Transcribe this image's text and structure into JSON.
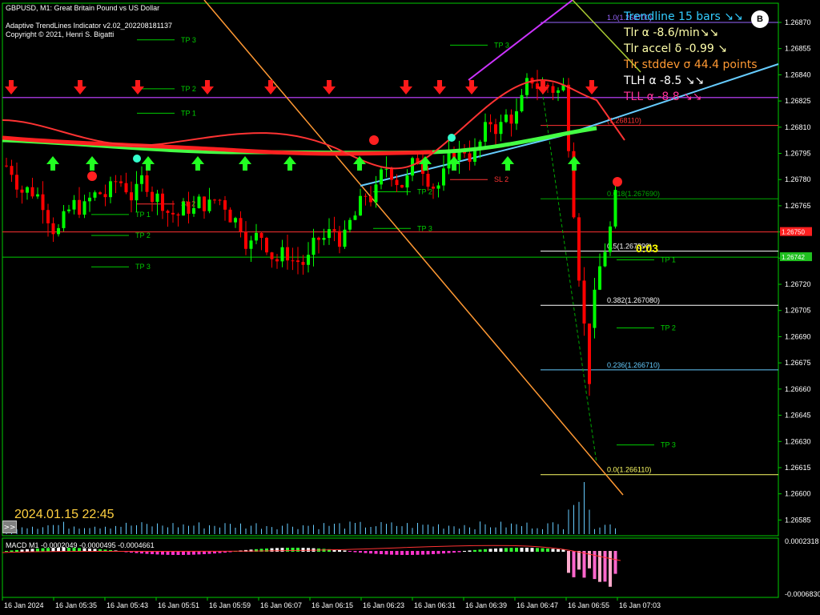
{
  "header": {
    "symbol_line": "GBPUSD, M1:  Great Britain Pound vs US Dollar",
    "indicator_line": "Adaptive TrendLines Indicator v2.02_202208181137",
    "copyright_line": "Copyright © 2021, Henri S. Bigatti"
  },
  "overlay": [
    {
      "text": "Trendline 15 bars ↘↘",
      "color": "#33ccff"
    },
    {
      "text": "Tlr α -8.6/min↘↘",
      "color": "#ffffaa"
    },
    {
      "text": "Tlr accel δ -0.99 ↘",
      "color": "#ffffaa"
    },
    {
      "text": "Tlr stddev σ 44.4 points",
      "color": "#ff9933"
    },
    {
      "text": "TLH α -8.5 ↘↘",
      "color": "#ffffff"
    },
    {
      "text": "TLL α -8.8 ↘↘",
      "color": "#ff3399"
    }
  ],
  "logo_text": "B",
  "timestamp": "2024.01.15 22:45",
  "bar_timer": "0:03",
  "scroll_button": ">>",
  "colors": {
    "axis": "#00cc00",
    "bull_candle": "#00ff00",
    "bear_candle": "#ff0000",
    "bg": "#000000"
  },
  "chart_data": {
    "type": "candlestick",
    "title": "GBPUSD, M1",
    "price_axis": {
      "ticks": [
        "1.26870",
        "1.26855",
        "1.26840",
        "1.26825",
        "1.26810",
        "1.26795",
        "1.26780",
        "1.26765",
        "1.26750",
        "1.26735",
        "1.26720",
        "1.26705",
        "1.26690",
        "1.26675",
        "1.26660",
        "1.26645",
        "1.26630",
        "1.26615",
        "1.26600",
        "1.26585"
      ],
      "ylim": [
        1.26576,
        1.26881
      ],
      "current_ask": "1.26750",
      "current_bid": "1.26742"
    },
    "time_axis": [
      "16 Jan 2024",
      "16 Jan 05:35",
      "16 Jan 05:43",
      "16 Jan 05:51",
      "16 Jan 05:59",
      "16 Jan 06:07",
      "16 Jan 06:15",
      "16 Jan 06:23",
      "16 Jan 06:31",
      "16 Jan 06:39",
      "16 Jan 06:47",
      "16 Jan 06:55",
      "16 Jan 07:03"
    ],
    "fib_levels": [
      {
        "label": "1.0(1.268700)",
        "price": 1.2687,
        "color": "#9966ff"
      },
      {
        "label": "(1.268110)",
        "price": 1.26811,
        "color": "#ff3333"
      },
      {
        "label": "0.618(1.267690)",
        "price": 1.26769,
        "color": "#00aa00"
      },
      {
        "label": "0.5(1.267390)",
        "price": 1.26739,
        "color": "#ffffff"
      },
      {
        "label": "0.382(1.267080)",
        "price": 1.26708,
        "color": "#ffffff"
      },
      {
        "label": "0.236(1.266710)",
        "price": 1.26671,
        "color": "#66ccff"
      },
      {
        "label": "0.0(1.266110)",
        "price": 1.26611,
        "color": "#ffff66"
      }
    ],
    "labels": [
      {
        "text": "TP 3",
        "price": 1.2686,
        "x": 226,
        "color": "#00cc00"
      },
      {
        "text": "TP 2",
        "price": 1.26832,
        "x": 226,
        "color": "#00cc00"
      },
      {
        "text": "TP 1",
        "price": 1.26818,
        "x": 226,
        "color": "#00cc00"
      },
      {
        "text": "SL 2",
        "price": 1.26766,
        "x": 226,
        "color": "#ff3333"
      },
      {
        "text": "TP 1",
        "price": 1.2676,
        "x": 169,
        "color": "#00cc00"
      },
      {
        "text": "TP 2",
        "price": 1.26748,
        "x": 169,
        "color": "#00cc00"
      },
      {
        "text": "TP 3",
        "price": 1.2673,
        "x": 169,
        "color": "#00cc00"
      },
      {
        "text": "TP 2",
        "price": 1.26773,
        "x": 521,
        "color": "#00cc00"
      },
      {
        "text": "TP 3",
        "price": 1.26752,
        "x": 521,
        "color": "#00cc00"
      },
      {
        "text": "SL 2",
        "price": 1.2678,
        "x": 617,
        "color": "#ff3333"
      },
      {
        "text": "TP 3",
        "price": 1.26857,
        "x": 617,
        "color": "#00cc00"
      },
      {
        "text": "TP 1",
        "price": 1.26734,
        "x": 825,
        "color": "#00cc00"
      },
      {
        "text": "TP 2",
        "price": 1.26695,
        "x": 825,
        "color": "#00cc00"
      },
      {
        "text": "TP 3",
        "price": 1.26628,
        "x": 825,
        "color": "#00cc00"
      }
    ],
    "macd": {
      "label": "MACD M1 -0.0002049 -0.0000495 -0.0004661",
      "axis_top": "0.0002318",
      "axis_bottom": "-0.0006830"
    }
  }
}
